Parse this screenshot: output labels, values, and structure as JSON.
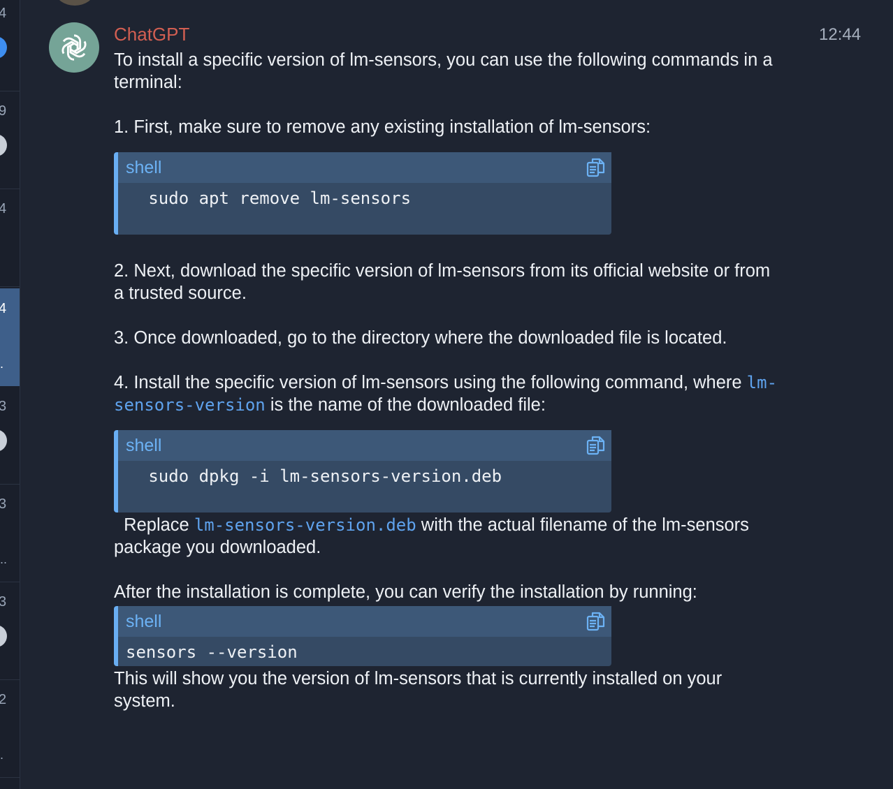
{
  "sidebar": {
    "rows": [
      {
        "num": "4",
        "dot": "blue",
        "ell": ""
      },
      {
        "num": "9",
        "dot": "gray",
        "ell": ""
      },
      {
        "num": "4",
        "dot": "",
        "ell": ""
      },
      {
        "num": "4",
        "dot": "",
        "ell": ".",
        "active": true
      },
      {
        "num": "3",
        "dot": "gray",
        "ell": ""
      },
      {
        "num": "3",
        "dot": "",
        "ell": ".."
      },
      {
        "num": "3",
        "dot": "gray",
        "ell": ""
      },
      {
        "num": "2",
        "dot": "",
        "ell": "."
      }
    ]
  },
  "message": {
    "sender": "ChatGPT",
    "time": "12:44",
    "intro": "To install a specific version of lm-sensors, you can use the following commands in a terminal:",
    "step1": "1. First, make sure to remove any existing installation of lm-sensors:",
    "code1": {
      "lang": "shell",
      "code": "   sudo apt remove lm-sensors"
    },
    "step2": "2. Next, download the specific version of lm-sensors from its official website or from a trusted source.",
    "step3": "3. Once downloaded, go to the directory where the downloaded file is located.",
    "step4_a": "4. Install the specific version of lm-sensors using the following command, where ",
    "step4_code": "lm-sensors-version",
    "step4_b": " is the name of the downloaded file:",
    "code2": {
      "lang": "shell",
      "code": "   sudo dpkg -i lm-sensors-version.deb"
    },
    "replace_a": "  Replace ",
    "replace_code": "lm-sensors-version.deb",
    "replace_b": " with the actual filename of the lm-sensors package you downloaded.",
    "after": "After the installation is complete, you can verify the installation by running:",
    "code3": {
      "lang": "shell",
      "code": "sensors --version"
    },
    "outro": "This will show you the version of lm-sensors that is currently installed on your system."
  },
  "icons": {
    "avatar": "openai-logo-icon",
    "copy": "copy-icon"
  },
  "colors": {
    "background": "#1e2431",
    "sender": "#d35f52",
    "code_accent": "#69aef3",
    "inline_code": "#5fa3ee"
  }
}
